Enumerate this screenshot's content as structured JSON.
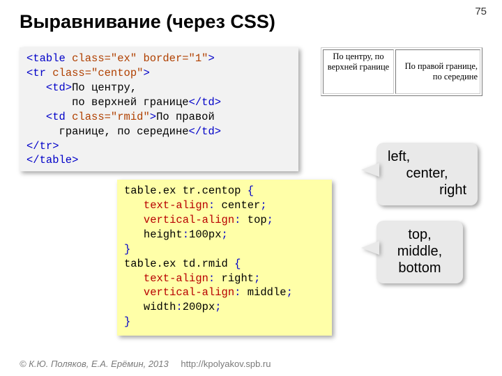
{
  "page_number": "75",
  "title": "Выравнивание (через CSS)",
  "html_code": {
    "table_attrs": "class=\"ex\" border=\"1\"",
    "tr_attrs": "class=\"centop\"",
    "td1_line1": "По центру,",
    "td1_line2": "по верхней границе",
    "td2_attrs": "class=\"rmid\"",
    "td2_line1": "По правой",
    "td2_line2": "границе, по середине"
  },
  "demo_table": {
    "cell1": "По центру, по верхней границе",
    "cell2": "По правой границе, по середине"
  },
  "callouts": {
    "align": [
      "left,",
      "center,",
      "right"
    ],
    "valign": [
      "top,",
      "middle,",
      "bottom"
    ]
  },
  "css_code": {
    "sel1": "table.ex tr.centop",
    "r1p1": "text-align",
    "r1v1": "center",
    "r1p2": "vertical-align",
    "r1v2": "top",
    "r1p3": "height",
    "r1v3": "100px",
    "sel2": "table.ex td.rmid",
    "r2p1": "text-align",
    "r2v1": "right",
    "r2p2": "vertical-align",
    "r2v2": "middle",
    "r2p3": "width",
    "r2v3": "200px"
  },
  "footer": {
    "copyright": "© К.Ю. Поляков, Е.А. Ерёмин, 2013",
    "url": "http://kpolyakov.spb.ru"
  }
}
